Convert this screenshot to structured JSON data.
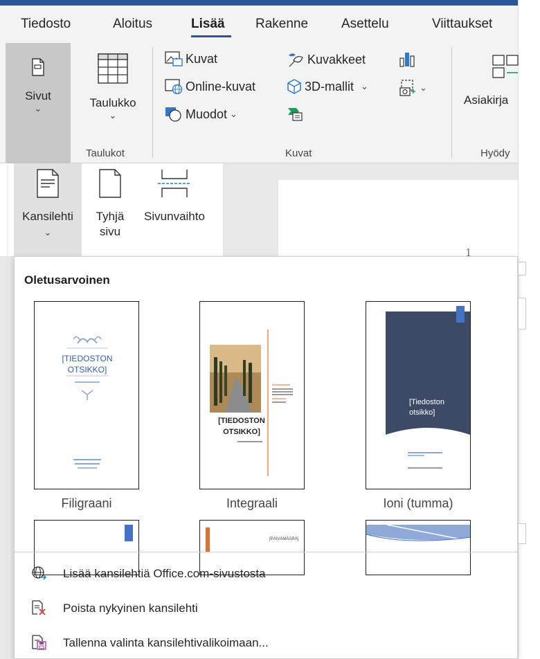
{
  "tabs": [
    "Tiedosto",
    "Aloitus",
    "Lisää",
    "Rakenne",
    "Asettelu",
    "Viittaukset"
  ],
  "ribbon": {
    "sivut": "Sivut",
    "taulukko": "Taulukko",
    "taulukot_group": "Taulukot",
    "kuvat": "Kuvat",
    "online_kuvat": "Online-kuvat",
    "muodot": "Muodot",
    "kuvakkeet": "Kuvakkeet",
    "mallit_3d": "3D-mallit",
    "kuvat_group": "Kuvat",
    "asiakirja": "Asiakirja",
    "hyody_group": "Hyödy"
  },
  "pages_dropdown": {
    "kansilehti": "Kansilehti",
    "tyhja_sivu_1": "Tyhjä",
    "tyhja_sivu_2": "sivu",
    "sivunvaihto": "Sivunvaihto"
  },
  "document": {
    "page_number": "1"
  },
  "gallery": {
    "heading": "Oletusarvoinen",
    "thumbnails": [
      {
        "name": "Filigraani"
      },
      {
        "name": "Integraali"
      },
      {
        "name": "Ioni (tumma)"
      }
    ],
    "filigraani_title_1": "[TIEDOSTON",
    "filigraani_title_2": "OTSIKKO]",
    "integraali_title_1": "[TIEDOSTON",
    "integraali_title_2": "OTSIKKO]",
    "ioni_title_1": "[Tiedoston",
    "ioni_title_2": "otsikko]",
    "row2_label": "[PÄIVÄMÄÄRÄ]"
  },
  "menu": {
    "more": "Lisää kansilehtiä Office.com-sivustosta",
    "remove": "Poista nykyinen kansilehti",
    "save": "Tallenna valinta kansilehtivalikoimaan..."
  },
  "colors": {
    "accent": "#2b579a",
    "orange": "#e07030",
    "ioni_dark": "#3c4a66",
    "ioni_blue": "#4472c4"
  }
}
